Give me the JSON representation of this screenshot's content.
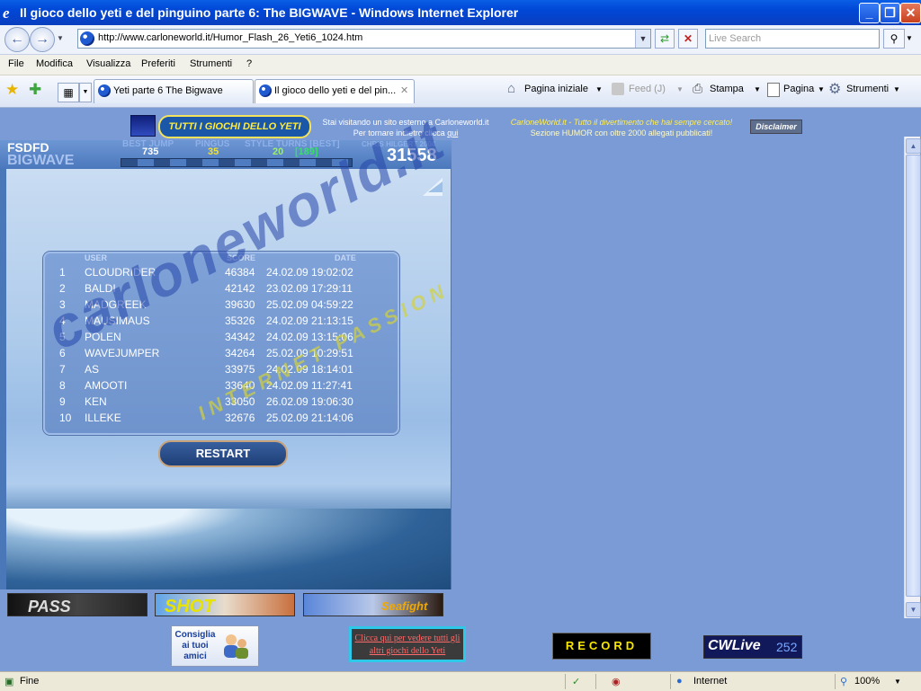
{
  "window": {
    "title": "Il gioco dello yeti e del pinguino parte 6: The BIGWAVE - Windows Internet Explorer",
    "minimize": "_",
    "maximize": "❐",
    "close": "✕"
  },
  "address": {
    "url": "http://www.carloneworld.it/Humor_Flash_26_Yeti6_1024.htm",
    "search_placeholder": "Live Search"
  },
  "menu": [
    "File",
    "Modifica",
    "Visualizza",
    "Preferiti",
    "Strumenti",
    "?"
  ],
  "tabs": [
    {
      "label": "Yeti parte 6 The Bigwave"
    },
    {
      "label": "Il gioco dello yeti e del pin..."
    }
  ],
  "toolbar": {
    "home": "Pagina iniziale",
    "feed": "Feed (J)",
    "print": "Stampa",
    "page": "Pagina",
    "tools": "Strumenti"
  },
  "banner": {
    "tutti_button": "TUTTI I GIOCHI DELLO YETI",
    "info_line1": "Stai visitando un sito esterno a Carloneworld.it",
    "info_line2": "Per tornare indietro clicca",
    "info_link": "qui",
    "cw_line1": "CarloneWorld.it - Tutto il divertimento che hai sempre cercato!",
    "cw_line2": "Sezione HUMOR con oltre 2000 allegati pubblicati!",
    "disclaimer": "Disclaimer"
  },
  "game": {
    "player": "FSDFD",
    "mode": "BIGWAVE",
    "labels": {
      "best_jump": "BEST JUMP",
      "pingus": "PINGUS",
      "style_turns": "STYLE TURNS [BEST]",
      "credit": "CHRIS HILGERT 2004"
    },
    "values": {
      "best_jump": "735",
      "pingus": "35",
      "style_turns": "20",
      "style_best": "[189]"
    },
    "score": "31558",
    "board_headers": {
      "user": "USER",
      "score": "SCORE",
      "date": "DATE"
    },
    "leaderboard": [
      {
        "rank": "1",
        "user": "CLOUDRIDER",
        "score": "46384",
        "date": "24.02.09 19:02:02"
      },
      {
        "rank": "2",
        "user": "BALDI",
        "score": "42142",
        "date": "23.02.09 17:29:11"
      },
      {
        "rank": "3",
        "user": "MADGREEK",
        "score": "39630",
        "date": "25.02.09 04:59:22"
      },
      {
        "rank": "4",
        "user": "MAUSIMAUS",
        "score": "35326",
        "date": "24.02.09 21:13:15"
      },
      {
        "rank": "5",
        "user": "POLEN",
        "score": "34342",
        "date": "24.02.09 13:15:06"
      },
      {
        "rank": "6",
        "user": "WAVEJUMPER",
        "score": "34264",
        "date": "25.02.09 10:29:51"
      },
      {
        "rank": "7",
        "user": "AS",
        "score": "33975",
        "date": "24.02.09 18:14:01"
      },
      {
        "rank": "8",
        "user": "AMOOTI",
        "score": "33640",
        "date": "24.02.09 11:27:41"
      },
      {
        "rank": "9",
        "user": "KEN",
        "score": "33050",
        "date": "26.02.09 19:06:30"
      },
      {
        "rank": "10",
        "user": "ILLEKE",
        "score": "32676",
        "date": "25.02.09 21:14:06"
      }
    ],
    "restart": "RESTART"
  },
  "thumbnails": [
    {
      "label": "PASS"
    },
    {
      "label": "SHOT"
    },
    {
      "label": "Seafight"
    }
  ],
  "bottom": {
    "consiglia": "Consiglia ai tuoi amici",
    "clicca": "Clicca qui per vedere tutti gli altri giochi dello Yeti",
    "record": "RECORD",
    "cwlive": "CWLive",
    "cwlive_count": "252"
  },
  "watermark": {
    "main": "carloneworld.it",
    "sub": "INTERNET PASSION"
  },
  "status": {
    "left": "Fine",
    "zone": "Internet",
    "zoom": "100%"
  },
  "colors": {
    "accent": "#0a5ee6",
    "page_bg": "#7b9bd6",
    "record_text": "#f6e600"
  }
}
